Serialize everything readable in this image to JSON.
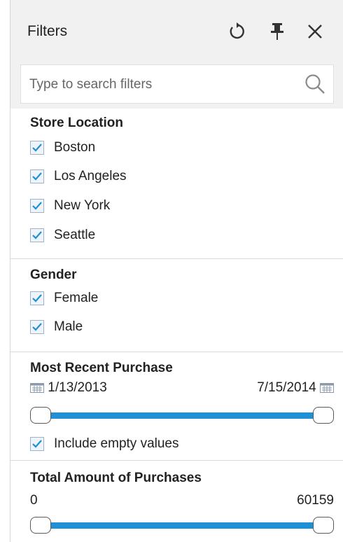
{
  "header": {
    "title": "Filters",
    "reset_icon": "reset-icon",
    "pin_icon": "pin-icon",
    "close_icon": "close-icon"
  },
  "search": {
    "placeholder": "Type to search filters",
    "value": "",
    "icon": "search-icon"
  },
  "store_location": {
    "title": "Store Location",
    "options": [
      {
        "label": "Boston",
        "checked": true
      },
      {
        "label": "Los Angeles",
        "checked": true
      },
      {
        "label": "New York",
        "checked": true
      },
      {
        "label": "Seattle",
        "checked": true
      }
    ]
  },
  "gender": {
    "title": "Gender",
    "options": [
      {
        "label": "Female",
        "checked": true
      },
      {
        "label": "Male",
        "checked": true
      }
    ]
  },
  "most_recent_purchase": {
    "title": "Most Recent Purchase",
    "start": "1/13/2013",
    "end": "7/15/2014",
    "range_start_fraction": 0,
    "range_end_fraction": 1,
    "include_empty_label": "Include empty values",
    "include_empty_checked": true,
    "calendar_icon": "calendar-icon"
  },
  "total_amount": {
    "title": "Total Amount of Purchases",
    "min": "0",
    "max": "60159",
    "range_start_fraction": 0,
    "range_end_fraction": 1
  },
  "colors": {
    "accent": "#1e90d6",
    "check": "#1e90d6",
    "panel_bg": "#f1f1f1"
  }
}
